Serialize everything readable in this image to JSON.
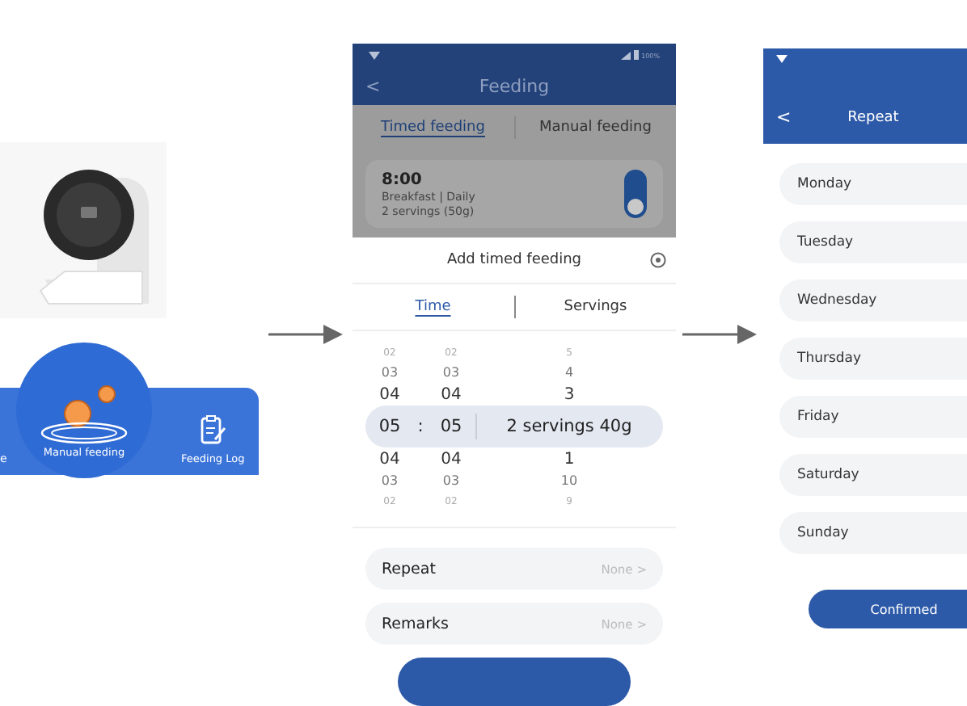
{
  "device_panel": {
    "tab_bar": [
      {
        "label": "e",
        "kind": "plain"
      },
      {
        "label": "Manual feeding",
        "kind": "bowl"
      },
      {
        "label": "Feeding Log",
        "kind": "log"
      }
    ]
  },
  "feeding_screen": {
    "status_bar": {
      "battery_text": "100%"
    },
    "title": "Feeding",
    "back": "<",
    "tabs": [
      {
        "label": "Timed feeding",
        "selected": true
      },
      {
        "label": "Manual feeding",
        "selected": false
      }
    ],
    "schedule": [
      {
        "time": "8:00",
        "meal": "Breakfast",
        "divider": "|",
        "repeat": "Daily",
        "amount": "2 servings (50g)",
        "on": true
      }
    ],
    "sheet": {
      "title": "Add timed feeding",
      "tabs": [
        {
          "label": "Time",
          "selected": true
        },
        {
          "label": "Servings",
          "selected": false
        }
      ],
      "picker": {
        "separator": ":",
        "rows": [
          {
            "hour": "02",
            "minute": "02",
            "servings": "5",
            "selected": false
          },
          {
            "hour": "03",
            "minute": "03",
            "servings": "4",
            "selected": false
          },
          {
            "hour": "04",
            "minute": "04",
            "servings": "3",
            "selected": false
          },
          {
            "hour": "05",
            "minute": "05",
            "servings": "2 servings  40g",
            "selected": true
          },
          {
            "hour": "04",
            "minute": "04",
            "servings": "1",
            "selected": false
          },
          {
            "hour": "03",
            "minute": "03",
            "servings": "10",
            "selected": false
          },
          {
            "hour": "02",
            "minute": "02",
            "servings": "9",
            "selected": false
          }
        ]
      },
      "options": [
        {
          "label": "Repeat",
          "value": "None",
          "chevron": ">"
        },
        {
          "label": "Remarks",
          "value": "None",
          "chevron": ">"
        }
      ]
    }
  },
  "repeat_screen": {
    "title": "Repeat",
    "back": "<",
    "days": [
      "Monday",
      "Tuesday",
      "Wednesday",
      "Thursday",
      "Friday",
      "Saturday",
      "Sunday"
    ],
    "confirm": "Confirmed"
  }
}
